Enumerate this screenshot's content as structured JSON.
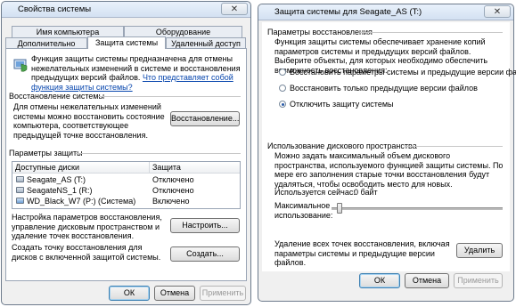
{
  "left_window": {
    "title": "Свойства системы",
    "close_label": "✕",
    "tabs_row1": [
      "Имя компьютера",
      "Оборудование"
    ],
    "tabs_row2": [
      "Дополнительно",
      "Защита системы",
      "Удаленный доступ"
    ],
    "intro_text": "Функция защиты системы предназначена для отмены нежелательных изменений в системе и восстановления предыдущих версий файлов.",
    "intro_link": "Что представляет собой функция защиты системы?",
    "restore_title": "Восстановление системы",
    "restore_text": "Для отмены нежелательных изменений системы можно восстановить состояние компьютера, соответствующее предыдущей точке восстановления.",
    "restore_button": "Восстановление...",
    "protection_title": "Параметры защиты",
    "table_headers": [
      "Доступные диски",
      "Защита"
    ],
    "drives": [
      {
        "name": "Seagate_AS (T:)",
        "status": "Отключено"
      },
      {
        "name": "SeagateNS_1 (R:)",
        "status": "Отключено"
      },
      {
        "name": "WD_Black_W7 (P:) (Система)",
        "status": "Включено"
      }
    ],
    "configure_text": "Настройка параметров восстановления, управление дисковым пространством и удаление точек восстановления.",
    "configure_button": "Настроить...",
    "create_text": "Создать точку восстановления для дисков с включенной защитой системы.",
    "create_button": "Создать...",
    "ok": "ОК",
    "cancel": "Отмена",
    "apply": "Применить"
  },
  "right_window": {
    "title": "Защита системы для Seagate_AS (T:)",
    "close_label": "✕",
    "restore_params_title": "Параметры восстановления",
    "restore_params_text": "Функция защиты системы обеспечивает хранение копий параметров системы и предыдущих версий файлов. Выберите объекты, для которых необходимо обеспечить возможность восстановления:",
    "radio_options": [
      {
        "label": "Восстановить параметры системы и предыдущие версии файлов",
        "checked": false
      },
      {
        "label": "Восстановить только предыдущие версии файлов",
        "checked": false
      },
      {
        "label": "Отключить защиту системы",
        "checked": true
      }
    ],
    "disk_usage_title": "Использование дискового пространства",
    "disk_usage_text": "Можно задать максимальный объем дискового пространства, используемого функцией защиты системы. По мере его заполнения старые точки восстановления будут удаляться, чтобы освободить место для новых.",
    "current_usage_label": "Используется сейчас:",
    "current_usage_value": "0 байт",
    "max_usage_label": "Максимальное использование:",
    "max_usage_fraction": 0,
    "delete_text": "Удаление всех точек восстановления, включая параметры системы и предыдущие версии файлов.",
    "delete_button": "Удалить",
    "ok": "ОК",
    "cancel": "Отмена",
    "apply": "Применить"
  }
}
